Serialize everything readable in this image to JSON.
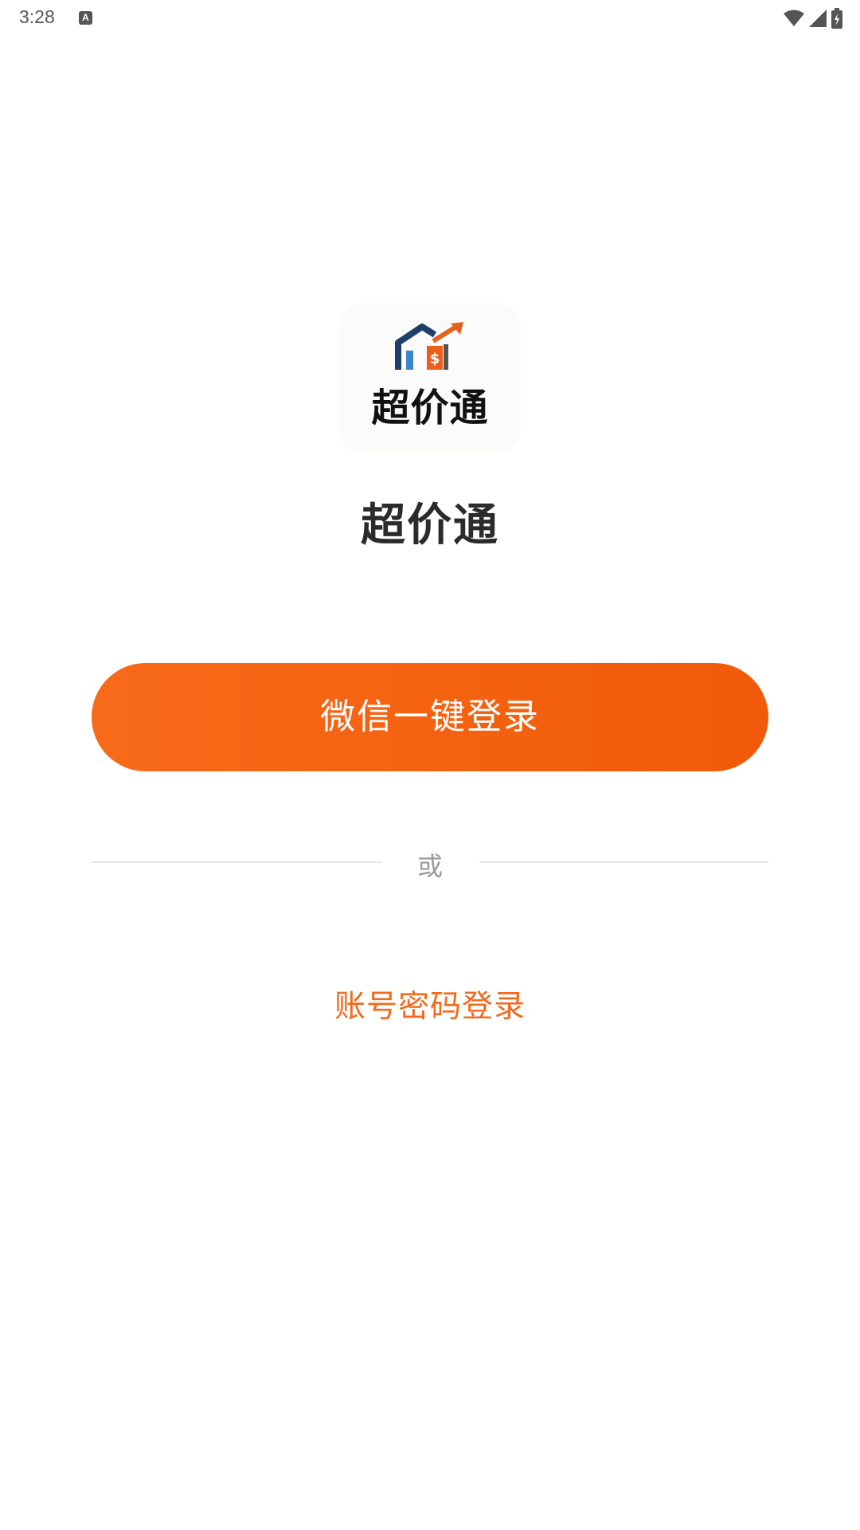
{
  "status_bar": {
    "time": "3:28",
    "notification_icon": "a-icon",
    "icons": [
      "wifi-icon",
      "signal-icon",
      "battery-charging-icon"
    ]
  },
  "logo": {
    "mark_icon": "house-price-up-icon",
    "text": "超价通"
  },
  "app_title": "超价通",
  "wechat_login_label": "微信一键登录",
  "divider_label": "或",
  "account_login_label": "账号密码登录",
  "colors": {
    "accent": "#f3610f",
    "link": "#f26a1b",
    "title": "#2b2b2b",
    "divider": "#e6e6e6"
  }
}
